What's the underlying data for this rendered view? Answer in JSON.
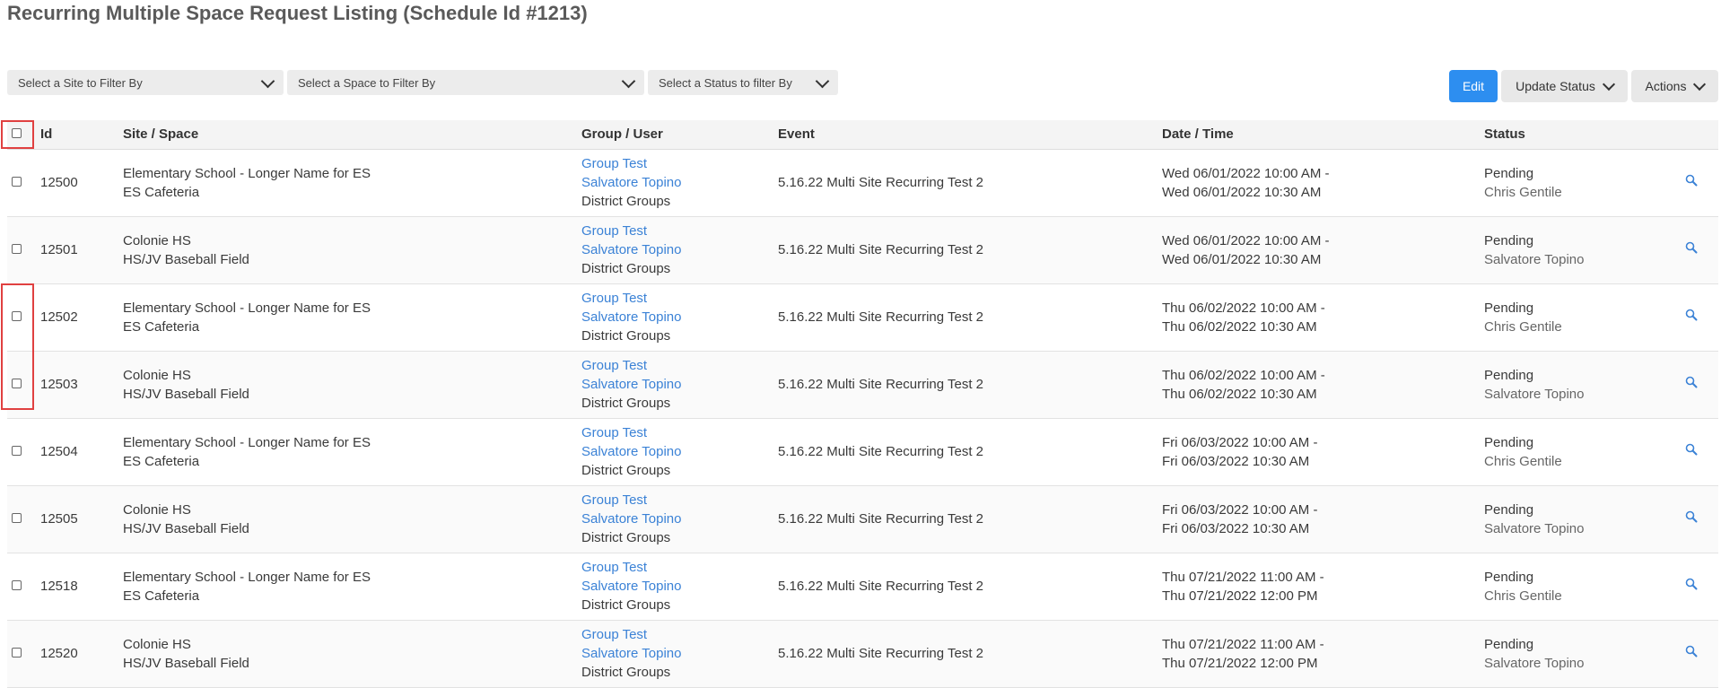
{
  "page": {
    "title": "Recurring Multiple Space Request Listing (Schedule Id #1213)"
  },
  "filters": {
    "site": "Select a Site to Filter By",
    "space": "Select a Space to Filter By",
    "status": "Select a Status to filter By"
  },
  "toolbar": {
    "edit": "Edit",
    "update_status": "Update Status",
    "actions": "Actions"
  },
  "table": {
    "headers": {
      "id": "Id",
      "site_space": "Site / Space",
      "group_user": "Group / User",
      "event": "Event",
      "date_time": "Date / Time",
      "status": "Status"
    },
    "rows": [
      {
        "id": "12500",
        "site": "Elementary School - Longer Name for ES",
        "space": "ES Cafeteria",
        "group": "Group Test",
        "user": "Salvatore Topino",
        "group_type": "District Groups",
        "event": "5.16.22 Multi Site Recurring Test 2",
        "start": "Wed 06/01/2022 10:00 AM -",
        "end": "Wed 06/01/2022 10:30 AM",
        "status": "Pending",
        "status_by": "Chris Gentile"
      },
      {
        "id": "12501",
        "site": "Colonie HS",
        "space": "HS/JV Baseball Field",
        "group": "Group Test",
        "user": "Salvatore Topino",
        "group_type": "District Groups",
        "event": "5.16.22 Multi Site Recurring Test 2",
        "start": "Wed 06/01/2022 10:00 AM -",
        "end": "Wed 06/01/2022 10:30 AM",
        "status": "Pending",
        "status_by": "Salvatore Topino"
      },
      {
        "id": "12502",
        "site": "Elementary School - Longer Name for ES",
        "space": "ES Cafeteria",
        "group": "Group Test",
        "user": "Salvatore Topino",
        "group_type": "District Groups",
        "event": "5.16.22 Multi Site Recurring Test 2",
        "start": "Thu 06/02/2022 10:00 AM -",
        "end": "Thu 06/02/2022 10:30 AM",
        "status": "Pending",
        "status_by": "Chris Gentile"
      },
      {
        "id": "12503",
        "site": "Colonie HS",
        "space": "HS/JV Baseball Field",
        "group": "Group Test",
        "user": "Salvatore Topino",
        "group_type": "District Groups",
        "event": "5.16.22 Multi Site Recurring Test 2",
        "start": "Thu 06/02/2022 10:00 AM -",
        "end": "Thu 06/02/2022 10:30 AM",
        "status": "Pending",
        "status_by": "Salvatore Topino"
      },
      {
        "id": "12504",
        "site": "Elementary School - Longer Name for ES",
        "space": "ES Cafeteria",
        "group": "Group Test",
        "user": "Salvatore Topino",
        "group_type": "District Groups",
        "event": "5.16.22 Multi Site Recurring Test 2",
        "start": "Fri 06/03/2022 10:00 AM -",
        "end": "Fri 06/03/2022 10:30 AM",
        "status": "Pending",
        "status_by": "Chris Gentile"
      },
      {
        "id": "12505",
        "site": "Colonie HS",
        "space": "HS/JV Baseball Field",
        "group": "Group Test",
        "user": "Salvatore Topino",
        "group_type": "District Groups",
        "event": "5.16.22 Multi Site Recurring Test 2",
        "start": "Fri 06/03/2022 10:00 AM -",
        "end": "Fri 06/03/2022 10:30 AM",
        "status": "Pending",
        "status_by": "Salvatore Topino"
      },
      {
        "id": "12518",
        "site": "Elementary School - Longer Name for ES",
        "space": "ES Cafeteria",
        "group": "Group Test",
        "user": "Salvatore Topino",
        "group_type": "District Groups",
        "event": "5.16.22 Multi Site Recurring Test 2",
        "start": "Thu 07/21/2022 11:00 AM -",
        "end": "Thu 07/21/2022 12:00 PM",
        "status": "Pending",
        "status_by": "Chris Gentile"
      },
      {
        "id": "12520",
        "site": "Colonie HS",
        "space": "HS/JV Baseball Field",
        "group": "Group Test",
        "user": "Salvatore Topino",
        "group_type": "District Groups",
        "event": "5.16.22 Multi Site Recurring Test 2",
        "start": "Thu 07/21/2022 11:00 AM -",
        "end": "Thu 07/21/2022 12:00 PM",
        "status": "Pending",
        "status_by": "Salvatore Topino"
      }
    ]
  },
  "icons": {
    "view": "magnifier-icon",
    "dropdown": "chevron-down-icon"
  },
  "colors": {
    "primary": "#2d8ef0",
    "link": "#3b82d6",
    "highlight": "#e04040"
  }
}
